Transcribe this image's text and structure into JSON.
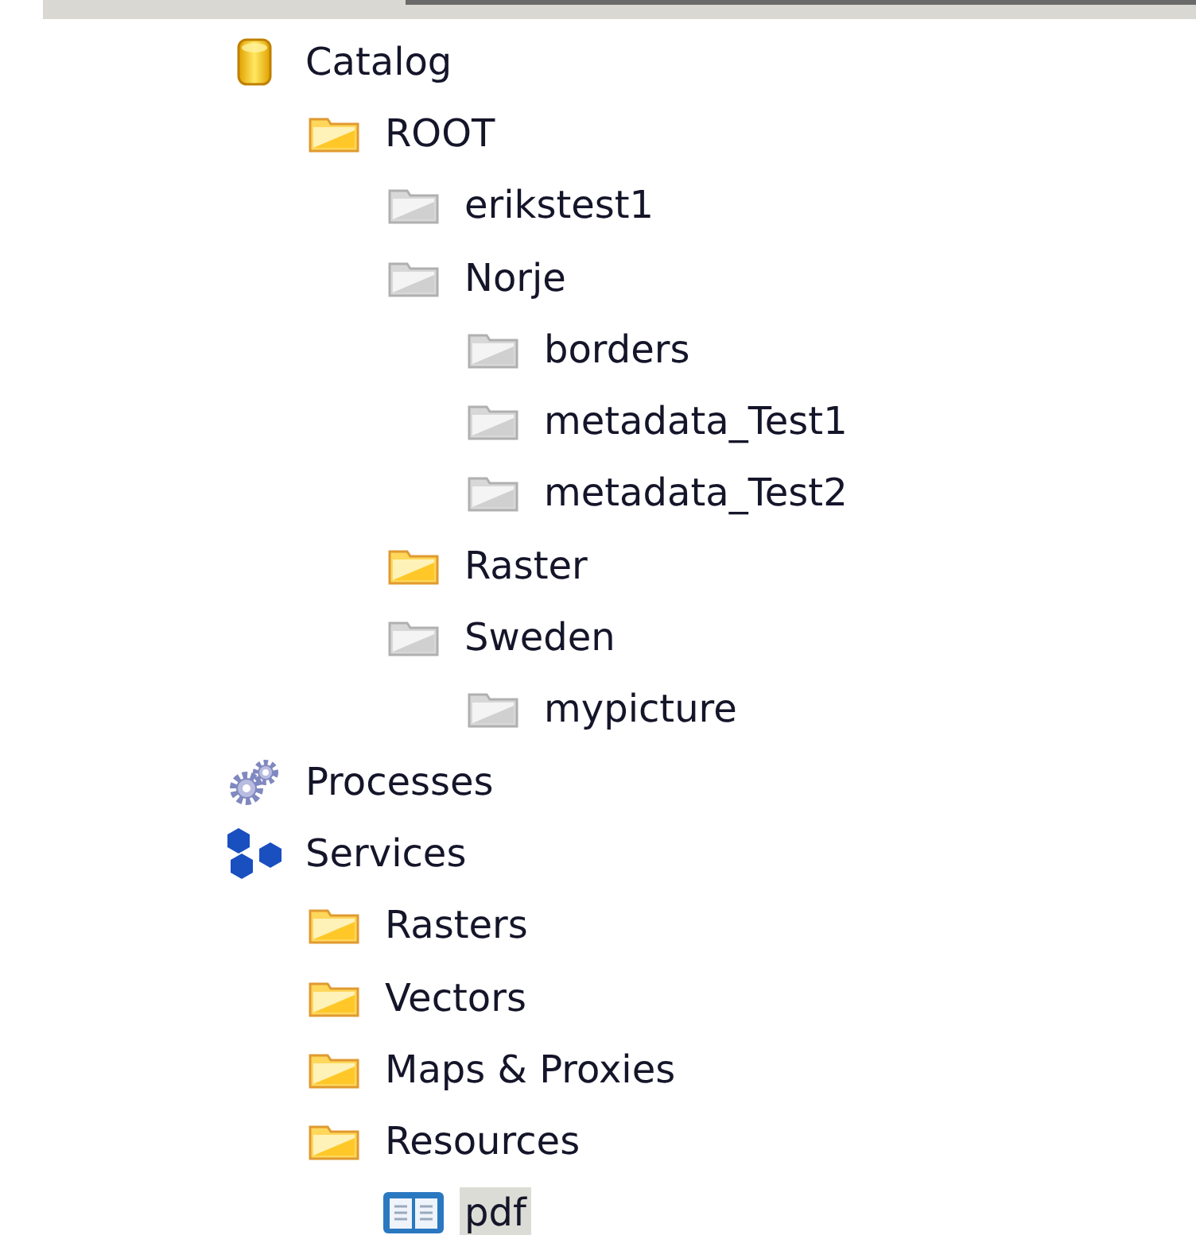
{
  "tree": [
    {
      "label": "Catalog",
      "kind": "database",
      "selected": false,
      "children": [
        {
          "label": "ROOT",
          "kind": "folder",
          "selected": false,
          "children": [
            {
              "label": "erikstest1",
              "kind": "gray-folder",
              "selected": false
            },
            {
              "label": "Norje",
              "kind": "gray-folder",
              "selected": false,
              "children": [
                {
                  "label": "borders",
                  "kind": "gray-folder",
                  "selected": false
                },
                {
                  "label": "metadata_Test1",
                  "kind": "gray-folder",
                  "selected": false
                },
                {
                  "label": "metadata_Test2",
                  "kind": "gray-folder",
                  "selected": false
                }
              ]
            },
            {
              "label": "Raster",
              "kind": "folder",
              "selected": false
            },
            {
              "label": "Sweden",
              "kind": "gray-folder",
              "selected": false,
              "children": [
                {
                  "label": "mypicture",
                  "kind": "gray-folder",
                  "selected": false
                }
              ]
            }
          ]
        }
      ]
    },
    {
      "label": "Processes",
      "kind": "gears",
      "selected": false
    },
    {
      "label": "Services",
      "kind": "services",
      "selected": false,
      "children": [
        {
          "label": "Rasters",
          "kind": "folder",
          "selected": false
        },
        {
          "label": "Vectors",
          "kind": "folder",
          "selected": false
        },
        {
          "label": "Maps & Proxies",
          "kind": "folder",
          "selected": false
        },
        {
          "label": "Resources",
          "kind": "folder",
          "selected": false,
          "children": [
            {
              "label": "pdf",
              "kind": "book",
              "selected": true
            }
          ]
        }
      ]
    }
  ]
}
